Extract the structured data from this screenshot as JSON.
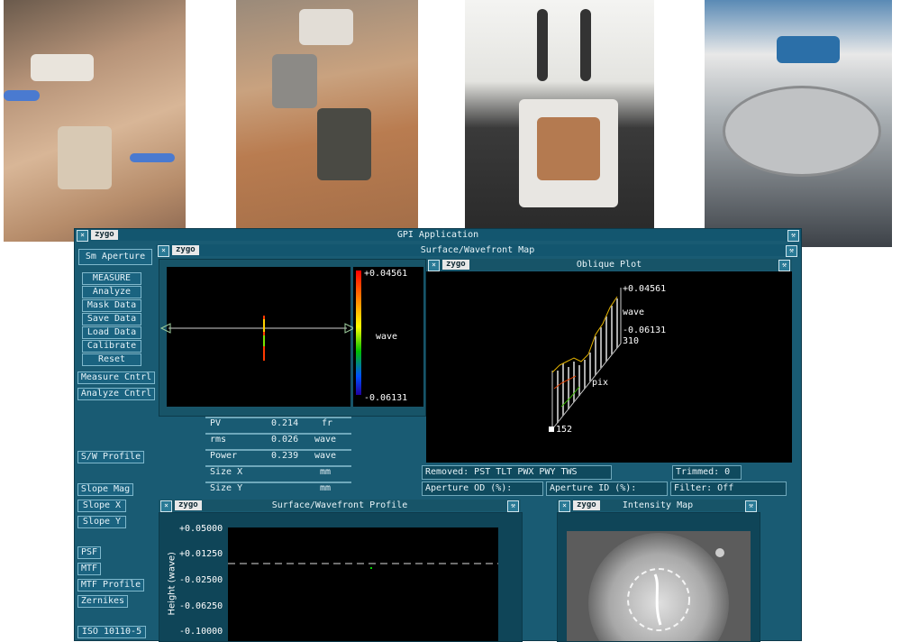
{
  "app": {
    "title": "GPI Application",
    "logo": "zygo",
    "left_buttons": {
      "aperture": "Sm Aperture",
      "measure": "MEASURE",
      "analyze": "Analyze",
      "mask_data": "Mask Data",
      "save_data": "Save Data",
      "load_data": "Load Data",
      "calibrate": "Calibrate",
      "reset": "Reset",
      "measure_cntrl": "Measure Cntrl",
      "analyze_cntrl": "Analyze Cntrl",
      "sw_profile": "S/W Profile",
      "slope_mag": "Slope Mag",
      "slope_x": "Slope X",
      "slope_y": "Slope Y",
      "psf": "PSF",
      "mtf": "MTF",
      "mtf_profile": "MTF Profile",
      "zernikes": "Zernikes",
      "iso": "ISO 10110-5"
    }
  },
  "surface_map": {
    "title": "Surface/Wavefront Map",
    "scale_max": "+0.04561",
    "scale_min": "-0.06131",
    "scale_unit": "wave"
  },
  "oblique": {
    "title": "Oblique Plot",
    "z_max": "+0.04561",
    "z_unit": "wave",
    "z_min": "-0.06131",
    "y_max": "310",
    "x_label": "pix",
    "x_max": "152"
  },
  "stats": [
    {
      "name": "PV",
      "value": "0.214",
      "unit": "fr"
    },
    {
      "name": "rms",
      "value": "0.026",
      "unit": "wave"
    },
    {
      "name": "Power",
      "value": "0.239",
      "unit": "wave"
    },
    {
      "name": "Size X",
      "value": "",
      "unit": "mm"
    },
    {
      "name": "Size Y",
      "value": "",
      "unit": "mm"
    }
  ],
  "info": {
    "removed": "Removed: PST TLT PWX PWY TWS",
    "trimmed": "Trimmed:  0",
    "aperture_od": "Aperture OD (%):",
    "aperture_id": "Aperture ID (%):",
    "filter": "Filter:     Off"
  },
  "profile": {
    "title": "Surface/Wavefront Profile",
    "ylabel": "Height (wave)",
    "ticks": [
      "+0.05000",
      "+0.01250",
      "-0.02500",
      "-0.06250",
      "-0.10000"
    ]
  },
  "intensity": {
    "title": "Intensity Map"
  }
}
